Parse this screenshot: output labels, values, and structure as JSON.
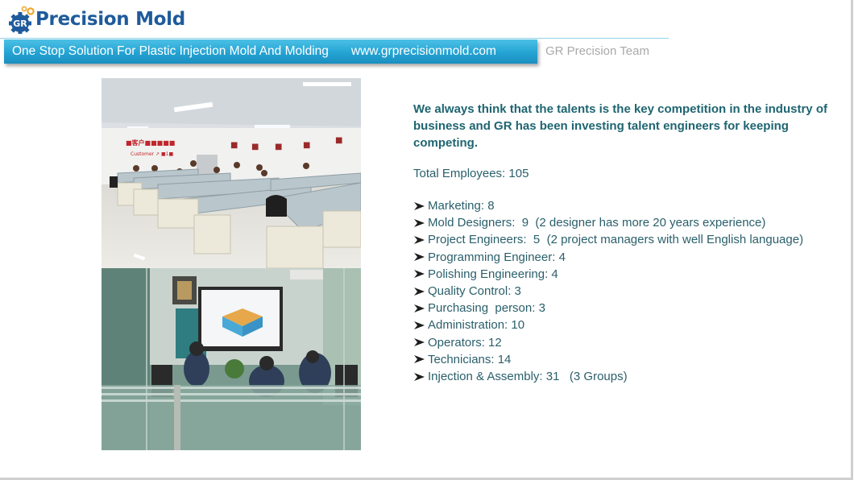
{
  "header": {
    "logo_text": "Precision Mold",
    "logo_badge": "GR",
    "slogan": "One Stop Solution For Plastic Injection Mold And Molding",
    "url": "www.grprecisionmold.com",
    "section_title": "GR Precision Team"
  },
  "colors": {
    "brand_blue": "#1f5b9b",
    "banner_blue": "#24a3d3",
    "gear_orange": "#f0a830",
    "text_teal": "#1e6571"
  },
  "photos": [
    {
      "name": "office-workspace-photo",
      "description": "Open office with engineers at desks"
    },
    {
      "name": "meeting-room-photo",
      "description": "Team meeting reviewing a mold design on a projector"
    }
  ],
  "content": {
    "intro": "We always think that the talents  is the key competition in the industry of business  and GR has  been investing  talent  engineers for keeping competing.",
    "total_label": "Total Employees: 105",
    "departments": [
      {
        "text": "Marketing: 8"
      },
      {
        "text": "Mold Designers:  9  (2 designer has more 20 years experience)"
      },
      {
        "text": "Project Engineers:  5  (2 project managers with well English language)"
      },
      {
        "text": "Programming Engineer: 4"
      },
      {
        "text": "Polishing Engineering: 4"
      },
      {
        "text": "Quality Control: 3"
      },
      {
        "text": "Purchasing  person: 3"
      },
      {
        "text": "Administration: 10"
      },
      {
        "text": "Operators: 12"
      },
      {
        "text": "Technicians: 14"
      },
      {
        "text": "Injection & Assembly: 31   (3 Groups)"
      }
    ]
  }
}
